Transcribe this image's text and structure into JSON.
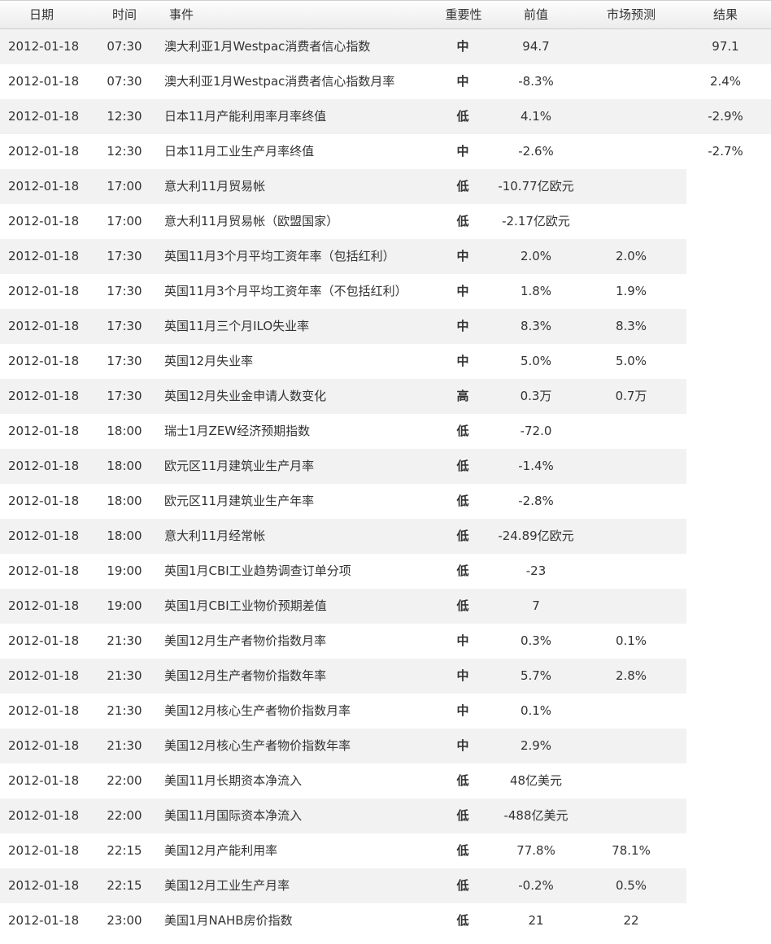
{
  "headers": {
    "date": "日期",
    "time": "时间",
    "event": "事件",
    "importance": "重要性",
    "previous": "前值",
    "forecast": "市场预测",
    "result": "结果"
  },
  "importance_colors": {
    "高": "#e00000",
    "中": "#0000cc",
    "低": "#008000"
  },
  "rows": [
    {
      "date": "2012-01-18",
      "time": "07:30",
      "event": "澳大利亚1月Westpac消费者信心指数",
      "importance": "中",
      "previous": "94.7",
      "forecast": "",
      "result": "97.1"
    },
    {
      "date": "2012-01-18",
      "time": "07:30",
      "event": "澳大利亚1月Westpac消费者信心指数月率",
      "importance": "中",
      "previous": "-8.3%",
      "forecast": "",
      "result": "2.4%"
    },
    {
      "date": "2012-01-18",
      "time": "12:30",
      "event": "日本11月产能利用率月率终值",
      "importance": "低",
      "previous": "4.1%",
      "forecast": "",
      "result": "-2.9%"
    },
    {
      "date": "2012-01-18",
      "time": "12:30",
      "event": "日本11月工业生产月率终值",
      "importance": "中",
      "previous": "-2.6%",
      "forecast": "",
      "result": "-2.7%"
    },
    {
      "date": "2012-01-18",
      "time": "17:00",
      "event": "意大利11月贸易帐",
      "importance": "低",
      "previous": "-10.77亿欧元",
      "forecast": "",
      "result": ""
    },
    {
      "date": "2012-01-18",
      "time": "17:00",
      "event": "意大利11月贸易帐（欧盟国家）",
      "importance": "低",
      "previous": "-2.17亿欧元",
      "forecast": "",
      "result": ""
    },
    {
      "date": "2012-01-18",
      "time": "17:30",
      "event": "英国11月3个月平均工资年率（包括红利）",
      "importance": "中",
      "previous": "2.0%",
      "forecast": "2.0%",
      "result": ""
    },
    {
      "date": "2012-01-18",
      "time": "17:30",
      "event": "英国11月3个月平均工资年率（不包括红利）",
      "importance": "中",
      "previous": "1.8%",
      "forecast": "1.9%",
      "result": ""
    },
    {
      "date": "2012-01-18",
      "time": "17:30",
      "event": "英国11月三个月ILO失业率",
      "importance": "中",
      "previous": "8.3%",
      "forecast": "8.3%",
      "result": ""
    },
    {
      "date": "2012-01-18",
      "time": "17:30",
      "event": "英国12月失业率",
      "importance": "中",
      "previous": "5.0%",
      "forecast": "5.0%",
      "result": ""
    },
    {
      "date": "2012-01-18",
      "time": "17:30",
      "event": "英国12月失业金申请人数变化",
      "importance": "高",
      "previous": "0.3万",
      "forecast": "0.7万",
      "result": ""
    },
    {
      "date": "2012-01-18",
      "time": "18:00",
      "event": "瑞士1月ZEW经济预期指数",
      "importance": "低",
      "previous": "-72.0",
      "forecast": "",
      "result": ""
    },
    {
      "date": "2012-01-18",
      "time": "18:00",
      "event": "欧元区11月建筑业生产月率",
      "importance": "低",
      "previous": "-1.4%",
      "forecast": "",
      "result": ""
    },
    {
      "date": "2012-01-18",
      "time": "18:00",
      "event": "欧元区11月建筑业生产年率",
      "importance": "低",
      "previous": "-2.8%",
      "forecast": "",
      "result": ""
    },
    {
      "date": "2012-01-18",
      "time": "18:00",
      "event": "意大利11月经常帐",
      "importance": "低",
      "previous": "-24.89亿欧元",
      "forecast": "",
      "result": ""
    },
    {
      "date": "2012-01-18",
      "time": "19:00",
      "event": "英国1月CBI工业趋势调查订单分项",
      "importance": "低",
      "previous": "-23",
      "forecast": "",
      "result": ""
    },
    {
      "date": "2012-01-18",
      "time": "19:00",
      "event": "英国1月CBI工业物价预期差值",
      "importance": "低",
      "previous": "7",
      "forecast": "",
      "result": ""
    },
    {
      "date": "2012-01-18",
      "time": "21:30",
      "event": "美国12月生产者物价指数月率",
      "importance": "中",
      "previous": "0.3%",
      "forecast": "0.1%",
      "result": ""
    },
    {
      "date": "2012-01-18",
      "time": "21:30",
      "event": "美国12月生产者物价指数年率",
      "importance": "中",
      "previous": "5.7%",
      "forecast": "2.8%",
      "result": ""
    },
    {
      "date": "2012-01-18",
      "time": "21:30",
      "event": "美国12月核心生产者物价指数月率",
      "importance": "中",
      "previous": "0.1%",
      "forecast": "",
      "result": ""
    },
    {
      "date": "2012-01-18",
      "time": "21:30",
      "event": "美国12月核心生产者物价指数年率",
      "importance": "中",
      "previous": "2.9%",
      "forecast": "",
      "result": ""
    },
    {
      "date": "2012-01-18",
      "time": "22:00",
      "event": "美国11月长期资本净流入",
      "importance": "低",
      "previous": "48亿美元",
      "forecast": "",
      "result": ""
    },
    {
      "date": "2012-01-18",
      "time": "22:00",
      "event": "美国11月国际资本净流入",
      "importance": "低",
      "previous": "-488亿美元",
      "forecast": "",
      "result": ""
    },
    {
      "date": "2012-01-18",
      "time": "22:15",
      "event": "美国12月产能利用率",
      "importance": "低",
      "previous": "77.8%",
      "forecast": "78.1%",
      "result": ""
    },
    {
      "date": "2012-01-18",
      "time": "22:15",
      "event": "美国12月工业生产月率",
      "importance": "低",
      "previous": "-0.2%",
      "forecast": "0.5%",
      "result": ""
    },
    {
      "date": "2012-01-18",
      "time": "23:00",
      "event": "美国1月NAHB房价指数",
      "importance": "低",
      "previous": "21",
      "forecast": "22",
      "result": ""
    }
  ]
}
